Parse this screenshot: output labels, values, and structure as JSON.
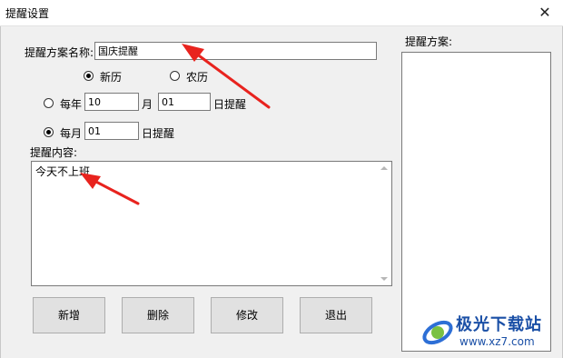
{
  "window": {
    "title": "提醒设置",
    "close_glyph": "✕"
  },
  "form": {
    "plan_name_label": "提醒方案名称:",
    "plan_name_value": "国庆提醒",
    "calendar": {
      "solar_label": "新历",
      "lunar_label": "农历",
      "selected": "新历"
    },
    "yearly": {
      "label": "每年",
      "month_value": "10",
      "month_label": "月",
      "day_value": "01",
      "day_label": "日提醒",
      "selected": false
    },
    "monthly": {
      "label": "每月",
      "day_value": "01",
      "day_label": "日提醒",
      "selected": true
    },
    "content_label": "提醒内容:",
    "content_value": "今天不上班"
  },
  "buttons": {
    "add": "新增",
    "delete": "删除",
    "modify": "修改",
    "exit": "退出"
  },
  "plans": {
    "label": "提醒方案:",
    "items": []
  },
  "watermark": {
    "name": "极光下载站",
    "url": "www.xz7.com"
  },
  "colors": {
    "annotation_arrow": "#e8231e",
    "watermark": "#1a4fa6"
  }
}
